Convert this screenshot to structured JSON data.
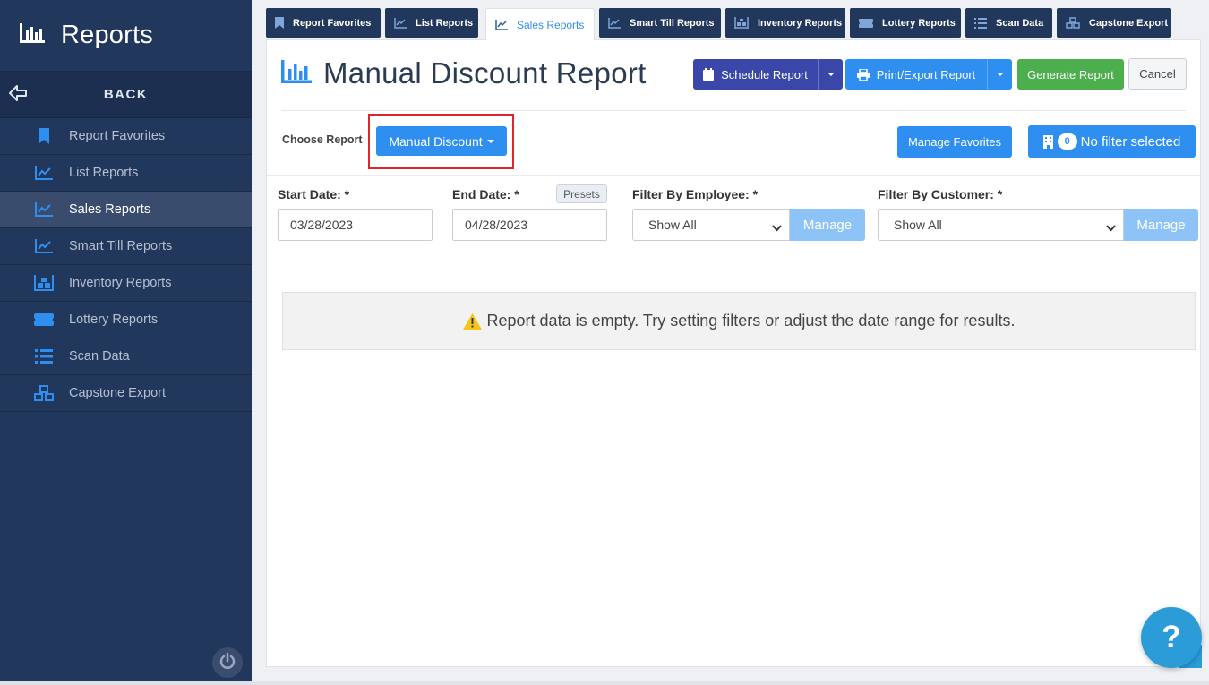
{
  "sidebar": {
    "title": "Reports",
    "back_label": "BACK",
    "items": [
      {
        "label": "Report Favorites",
        "icon": "bookmark-icon"
      },
      {
        "label": "List Reports",
        "icon": "line-chart-icon"
      },
      {
        "label": "Sales Reports",
        "icon": "line-chart-icon",
        "active": true
      },
      {
        "label": "Smart Till Reports",
        "icon": "line-chart-icon"
      },
      {
        "label": "Inventory Reports",
        "icon": "warehouse-icon"
      },
      {
        "label": "Lottery Reports",
        "icon": "ticket-icon"
      },
      {
        "label": "Scan Data",
        "icon": "list-icon"
      },
      {
        "label": "Capstone Export",
        "icon": "cubes-icon"
      }
    ]
  },
  "tabs": [
    {
      "label": "Report Favorites"
    },
    {
      "label": "List Reports"
    },
    {
      "label": "Sales Reports",
      "active": true
    },
    {
      "label": "Smart Till Reports"
    },
    {
      "label": "Inventory Reports"
    },
    {
      "label": "Lottery Reports"
    },
    {
      "label": "Scan Data"
    },
    {
      "label": "Capstone Export"
    }
  ],
  "header": {
    "title": "Manual Discount Report",
    "schedule_label": "Schedule Report",
    "print_label": "Print/Export Report",
    "generate_label": "Generate Report",
    "cancel_label": "Cancel"
  },
  "report_select": {
    "choose_label": "Choose Report",
    "selected": "Manual Discount",
    "favorites_label": "Manage Favorites",
    "filter_count": "0",
    "filter_label": "No filter selected"
  },
  "filters": {
    "start_date_label": "Start Date: *",
    "start_date": "03/28/2023",
    "end_date_label": "End Date: *",
    "end_date": "04/28/2023",
    "presets_label": "Presets",
    "employee_label": "Filter By Employee: *",
    "employee_value": "Show All",
    "customer_label": "Filter By Customer: *",
    "customer_value": "Show All",
    "manage_label": "Manage"
  },
  "empty_message": "Report data is empty. Try setting filters or adjust the date range for results.",
  "help_label": "?",
  "colors": {
    "sidebar": "#22375c",
    "primary": "#2f8ff0",
    "schedule": "#3a47a8",
    "generate": "#4cae4c",
    "highlight": "#e0242b"
  }
}
